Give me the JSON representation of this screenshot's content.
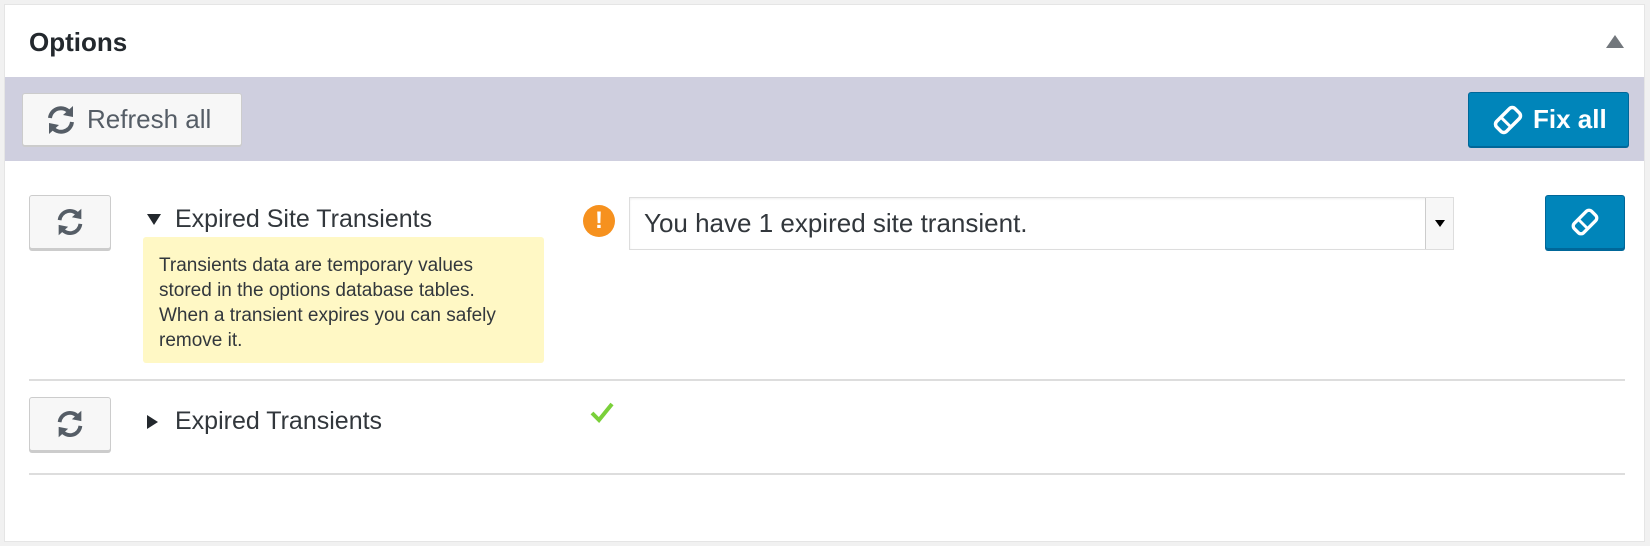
{
  "panel": {
    "title": "Options",
    "collapse_icon": "arrow-up-icon"
  },
  "toolbar": {
    "refresh_all_label": "Refresh all",
    "refresh_icon": "refresh-icon",
    "fix_all_label": "Fix all",
    "fix_icon": "eraser-icon"
  },
  "rows": [
    {
      "title": "Expired Site Transients",
      "expanded": true,
      "status": "warning",
      "help_text": "Transients data are temporary values stored in the options database tables. When a transient expires you can safely remove it.",
      "message": "You have 1 expired site transient."
    },
    {
      "title": "Expired Transients",
      "expanded": false,
      "status": "ok"
    }
  ],
  "colors": {
    "toolbar_bg": "#cfcfdf",
    "primary_button": "#0085ba",
    "warning": "#f6911e",
    "ok": "#7ad03a",
    "help_bg": "#fff8c5"
  }
}
